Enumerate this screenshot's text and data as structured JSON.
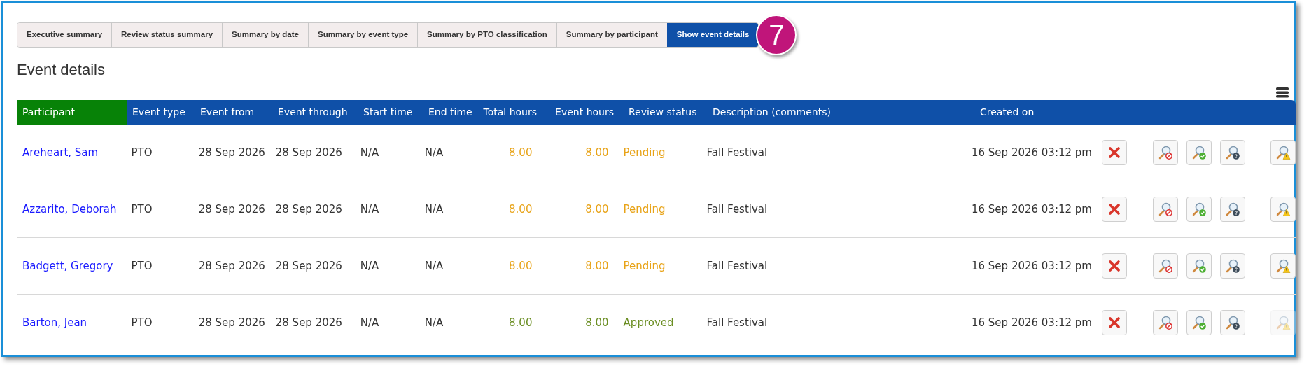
{
  "tabs": [
    {
      "label": "Executive summary",
      "selected": false
    },
    {
      "label": "Review status summary",
      "selected": false
    },
    {
      "label": "Summary by date",
      "selected": false
    },
    {
      "label": "Summary by event type",
      "selected": false
    },
    {
      "label": "Summary by PTO classification",
      "selected": false
    },
    {
      "label": "Summary by participant",
      "selected": false
    },
    {
      "label": "Show event details",
      "selected": true
    }
  ],
  "step_badge": "7",
  "heading": "Event details",
  "table": {
    "columns": [
      "Participant",
      "Event type",
      "Event from",
      "Event through",
      "Start time",
      "End time",
      "Total hours",
      "Event hours",
      "Review status",
      "Description (comments)",
      "Created on"
    ],
    "rows": [
      {
        "participant": "Areheart, Sam",
        "event_type": "PTO",
        "event_from": "28 Sep 2026",
        "event_through": "28 Sep 2026",
        "start_time": "N/A",
        "end_time": "N/A",
        "total_hours": "8.00",
        "event_hours": "8.00",
        "review_status": "Pending",
        "color": "#e8a317",
        "description": "Fall Festival",
        "created_on": "16 Sep 2026 03:12 pm",
        "flag_disabled": false
      },
      {
        "participant": "Azzarito, Deborah",
        "event_type": "PTO",
        "event_from": "28 Sep 2026",
        "event_through": "28 Sep 2026",
        "start_time": "N/A",
        "end_time": "N/A",
        "total_hours": "8.00",
        "event_hours": "8.00",
        "review_status": "Pending",
        "color": "#e8a317",
        "description": "Fall Festival",
        "created_on": "16 Sep 2026 03:12 pm",
        "flag_disabled": false
      },
      {
        "participant": "Badgett, Gregory",
        "event_type": "PTO",
        "event_from": "28 Sep 2026",
        "event_through": "28 Sep 2026",
        "start_time": "N/A",
        "end_time": "N/A",
        "total_hours": "8.00",
        "event_hours": "8.00",
        "review_status": "Pending",
        "color": "#e8a317",
        "description": "Fall Festival",
        "created_on": "16 Sep 2026 03:12 pm",
        "flag_disabled": false
      },
      {
        "participant": "Barton, Jean",
        "event_type": "PTO",
        "event_from": "28 Sep 2026",
        "event_through": "28 Sep 2026",
        "start_time": "N/A",
        "end_time": "N/A",
        "total_hours": "8.00",
        "event_hours": "8.00",
        "review_status": "Approved",
        "color": "#6b8e23",
        "description": "Fall Festival",
        "created_on": "16 Sep 2026 03:12 pm",
        "flag_disabled": true
      }
    ]
  }
}
